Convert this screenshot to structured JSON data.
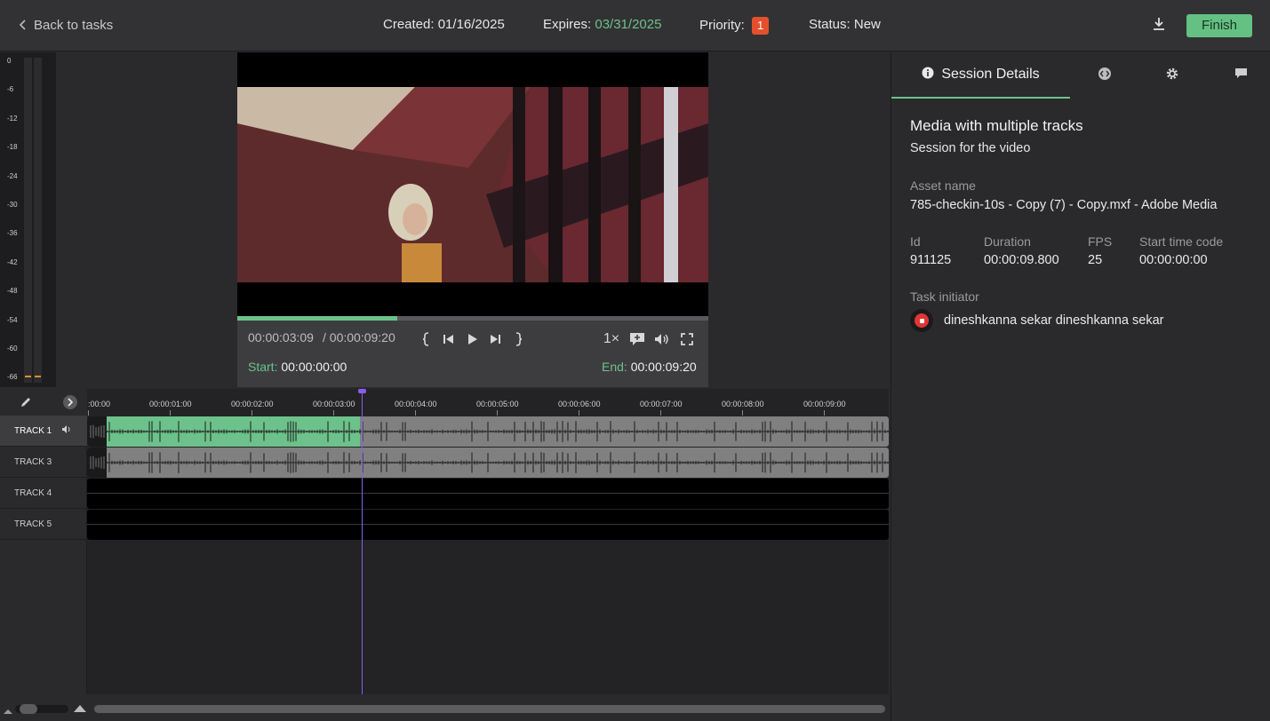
{
  "header": {
    "back_label": "Back to tasks",
    "created_label": "Created:",
    "created_value": "01/16/2025",
    "expires_label": "Expires:",
    "expires_value": "03/31/2025",
    "priority_label": "Priority:",
    "priority_value": "1",
    "status_label": "Status:",
    "status_value": "New",
    "finish_label": "Finish",
    "download_icon": "download-icon"
  },
  "meter": {
    "ticks": [
      "0",
      "-6",
      "-12",
      "-18",
      "-24",
      "-30",
      "-36",
      "-42",
      "-48",
      "-54",
      "-60",
      "-66"
    ]
  },
  "player": {
    "current_time": "00:00:03:09",
    "total_time": "/ 00:00:09:20",
    "progress_fraction": 0.34,
    "speed_label": "1×",
    "start_label": "Start:",
    "start_value": "00:00:00:00",
    "end_label": "End:",
    "end_value": "00:00:09:20",
    "icons": [
      "mark-in-icon",
      "step-back-icon",
      "play-icon",
      "step-forward-icon",
      "mark-out-icon",
      "comment-add-icon",
      "volume-icon",
      "fullscreen-icon"
    ]
  },
  "timeline": {
    "ruler_labels": [
      ":00:00",
      "00:00:01:00",
      "00:00:02:00",
      "00:00:03:00",
      "00:00:04:00",
      "00:00:05:00",
      "00:00:06:00",
      "00:00:07:00",
      "00:00:08:00",
      "00:00:09:00"
    ],
    "tracks": [
      {
        "name": "TRACK 1",
        "selected": true,
        "has_audio": true
      },
      {
        "name": "TRACK 3",
        "selected": false,
        "has_audio": true
      },
      {
        "name": "TRACK 4",
        "selected": false,
        "has_audio": false
      },
      {
        "name": "TRACK 5",
        "selected": false,
        "has_audio": false
      }
    ],
    "played_fraction": 0.34,
    "accent": "#6cc28a",
    "playhead_color": "#8a5cf0"
  },
  "panel": {
    "tabs": [
      {
        "label": "Session Details",
        "icon": "info-icon",
        "active": true
      },
      {
        "label": "",
        "icon": "code-icon",
        "active": false
      },
      {
        "label": "",
        "icon": "gear-icon",
        "active": false
      },
      {
        "label": "",
        "icon": "chat-icon",
        "active": false
      }
    ],
    "title": "Media with multiple tracks",
    "subtitle": "Session for the video",
    "asset_label": "Asset name",
    "asset_value": "785-checkin-10s - Copy (7) - Copy.mxf - Adobe Media",
    "id_label": "Id",
    "id_value": "911125",
    "duration_label": "Duration",
    "duration_value": "00:00:09.800",
    "fps_label": "FPS",
    "fps_value": "25",
    "stc_label": "Start time code",
    "stc_value": "00:00:00:00",
    "initiator_label": "Task initiator",
    "initiator_name": "dineshkanna sekar dineshkanna sekar"
  },
  "colors": {
    "green": "#6cc28a",
    "priority": "#e4502c",
    "purple": "#8a5cf0"
  }
}
